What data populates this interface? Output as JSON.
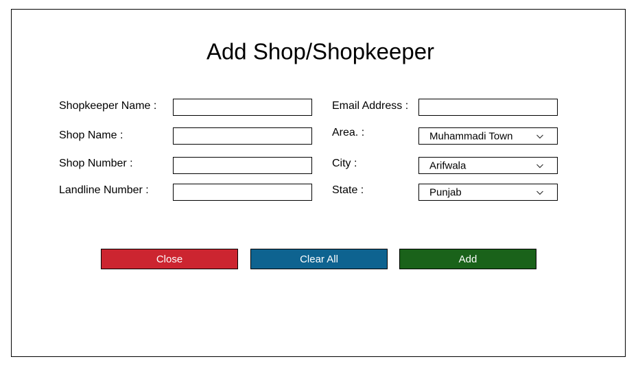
{
  "dialog": {
    "title": "Add Shop/Shopkeeper"
  },
  "form": {
    "shopkeeper_name": {
      "label": "Shopkeeper Name :",
      "value": ""
    },
    "shop_name": {
      "label": "Shop Name :",
      "value": ""
    },
    "shop_number": {
      "label": "Shop Number :",
      "value": ""
    },
    "landline_number": {
      "label": "Landline Number :",
      "value": ""
    },
    "email_address": {
      "label": "Email Address :",
      "value": ""
    },
    "area": {
      "label": "Area. :",
      "selected": "Muhammadi Town",
      "icon": "chevron-down-icon"
    },
    "city": {
      "label": "City :",
      "selected": "Arifwala",
      "icon": "chevron-down-icon"
    },
    "state": {
      "label": "State :",
      "selected": "Punjab",
      "icon": "chevron-down-icon"
    }
  },
  "buttons": {
    "close": {
      "label": "Close",
      "color": "#CC2530"
    },
    "clear_all": {
      "label": "Clear All",
      "color": "#0E6390"
    },
    "add": {
      "label": "Add",
      "color": "#1A621A"
    }
  }
}
